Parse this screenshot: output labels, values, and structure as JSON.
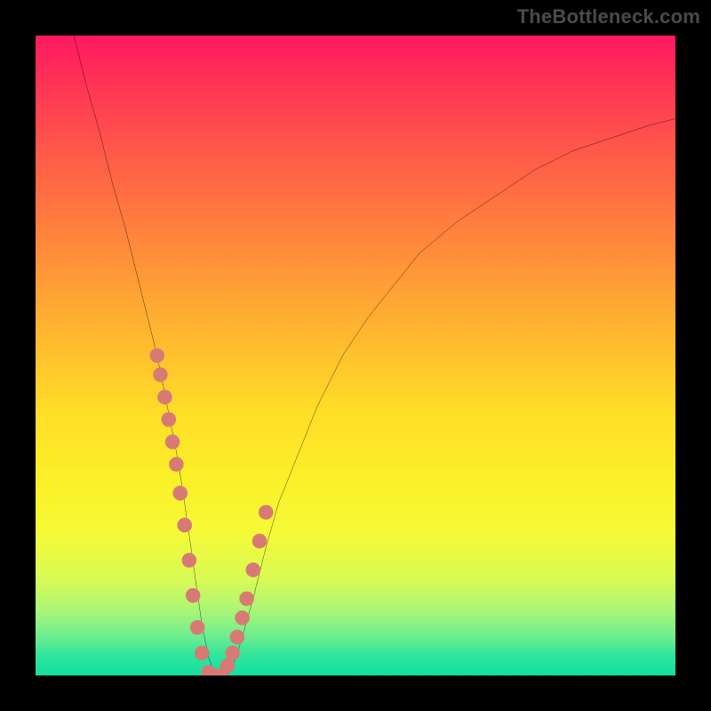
{
  "watermark": "TheBottleneck.com",
  "colors": {
    "frame_bg": "#000000",
    "curve_stroke": "#000000",
    "point_fill": "#d87a74",
    "gradient_stops": [
      "#ff1860",
      "#ff3555",
      "#ff5f47",
      "#ff8a3b",
      "#ffb530",
      "#ffde28",
      "#fbf128",
      "#f4fa38",
      "#d8fa55",
      "#a8f577",
      "#6bed8f",
      "#2fe59d",
      "#12e0a2"
    ]
  },
  "chart_data": {
    "type": "line",
    "title": "",
    "xlabel": "",
    "ylabel": "",
    "xlim": [
      0,
      100
    ],
    "ylim": [
      0,
      100
    ],
    "series": [
      {
        "name": "curve",
        "x": [
          6,
          8,
          10,
          12,
          14,
          16,
          18,
          19,
          20,
          21,
          22,
          23,
          24,
          25,
          26,
          27,
          28,
          29,
          30,
          31,
          32,
          34,
          36,
          38,
          40,
          44,
          48,
          52,
          56,
          60,
          66,
          72,
          78,
          84,
          90,
          96,
          100
        ],
        "y": [
          100,
          92,
          85,
          77,
          70,
          62,
          54,
          50,
          45,
          40,
          35,
          29,
          22,
          15,
          8,
          3,
          0,
          0,
          0,
          2,
          5,
          12,
          20,
          27,
          32,
          42,
          50,
          56,
          61,
          66,
          71,
          75,
          79,
          82,
          84,
          86,
          87
        ]
      }
    ],
    "highlight_points": {
      "name": "cluster",
      "x": [
        19.0,
        19.5,
        20.2,
        20.8,
        21.4,
        22.0,
        22.6,
        23.3,
        24.0,
        24.6,
        25.3,
        26.0,
        27.0,
        28.0,
        29.0,
        30.0,
        30.8,
        31.5,
        32.3,
        33.0,
        34.0,
        35.0,
        36.0
      ],
      "y": [
        50.0,
        47.0,
        43.5,
        40.0,
        36.5,
        33.0,
        28.5,
        23.5,
        18.0,
        12.5,
        7.5,
        3.5,
        0.5,
        0.0,
        0.0,
        1.5,
        3.5,
        6.0,
        9.0,
        12.0,
        16.5,
        21.0,
        25.5
      ]
    }
  }
}
